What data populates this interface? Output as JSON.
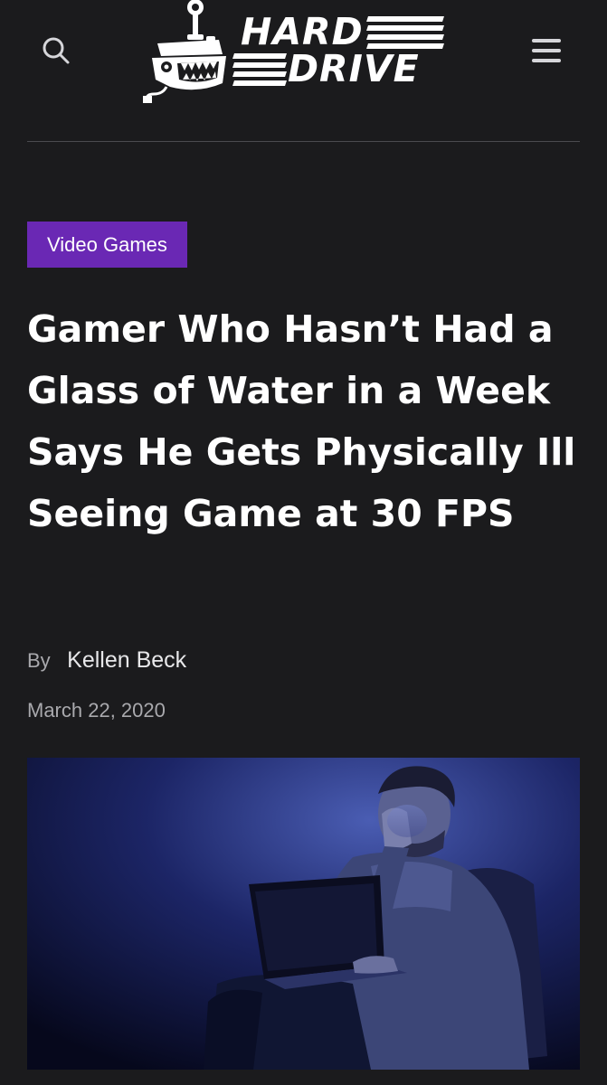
{
  "header": {
    "search_icon": "search-icon",
    "menu_icon": "hamburger-menu-icon",
    "logo": {
      "line1": "HARD",
      "line2": "DRIVE",
      "mascot_icon": "joystick-mascot-icon"
    }
  },
  "article": {
    "category": "Video Games",
    "title": "Gamer Who Hasn’t Had a Glass of Water in a Week Says He Gets Physically Ill Seeing Game at 30 FPS",
    "byline_prefix": "By",
    "author": "Kellen Beck",
    "date": "March 22, 2020"
  },
  "colors": {
    "background": "#1b1b1d",
    "category_tag": "#6a28b4",
    "divider": "#4a4a4e",
    "meta_text": "#a9a9ad"
  }
}
